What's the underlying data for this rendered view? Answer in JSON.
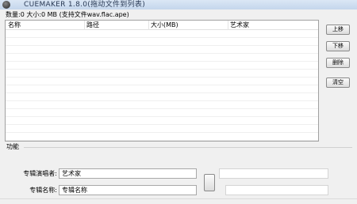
{
  "window": {
    "title": "CUEMAKER 1.8.0(拖动文件到列表)",
    "icon": "app-disc-icon"
  },
  "status_text": "数量:0 大小:0 MB  (支持文件wav.flac.ape)",
  "file_list": {
    "columns": [
      "名称",
      "路径",
      "大小(MB)",
      "艺术家"
    ],
    "rows": []
  },
  "side_buttons": {
    "move_up": "上移",
    "move_down": "下移",
    "delete": "删除",
    "clear": "清空"
  },
  "function_group": {
    "title": "功能",
    "album_artist_label": "专辑演唱者:",
    "album_artist_value": "艺术家",
    "album_name_label": "专辑名称:",
    "album_name_value": "专辑名称"
  }
}
